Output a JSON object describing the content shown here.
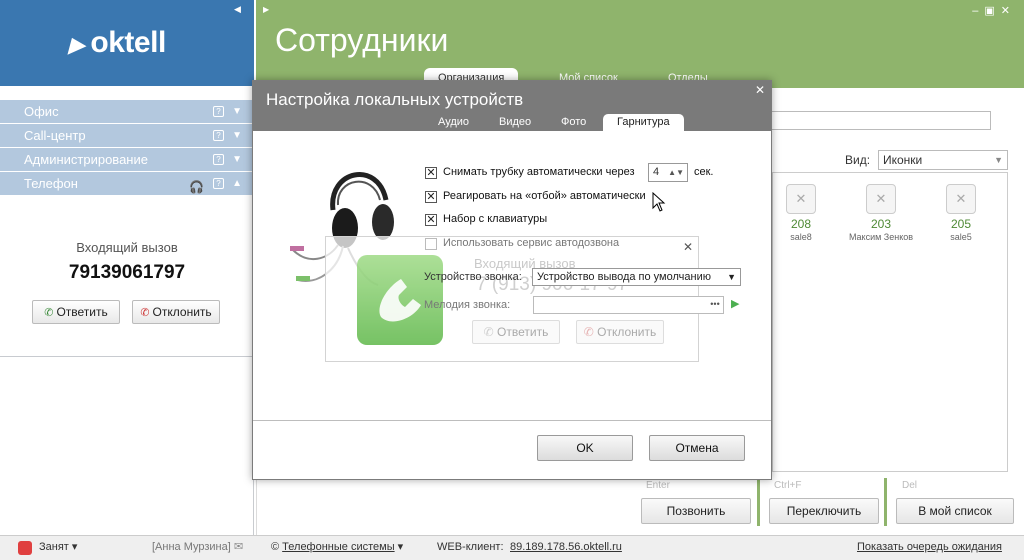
{
  "brand": {
    "logo": "oktell"
  },
  "sidebar": {
    "items": [
      {
        "label": "Офис",
        "expanded": false
      },
      {
        "label": "Call-центр",
        "expanded": false
      },
      {
        "label": "Администрирование",
        "expanded": false
      },
      {
        "label": "Телефон",
        "expanded": true
      }
    ],
    "incoming_label": "Входящий вызов",
    "incoming_number": "79139061797",
    "answer_label": "Ответить",
    "decline_label": "Отклонить"
  },
  "main": {
    "title": "Сотрудники",
    "tabs": [
      "Организация",
      "Мой список",
      "Отделы"
    ],
    "active_tab": "Организация",
    "view_label": "Вид:",
    "view_value": "Иконки",
    "employees": [
      {
        "num": "208",
        "name": "sale8"
      },
      {
        "num": "203",
        "name": "Максим Зенков"
      },
      {
        "num": "205",
        "name": "sale5"
      }
    ],
    "hints": [
      "Enter",
      "Ctrl+F",
      "Del"
    ],
    "buttons": [
      "Позвонить",
      "Переключить",
      "В мой список"
    ]
  },
  "dialog": {
    "title": "Настройка локальных устройств",
    "tabs": [
      "Аудио",
      "Видео",
      "Фото",
      "Гарнитура"
    ],
    "active_tab": "Гарнитура",
    "auto_pickup_label": "Снимать трубку автоматически через",
    "auto_pickup_value": "4",
    "auto_pickup_unit": "сек.",
    "auto_hangup_label": "Реагировать на «отбой» автоматически",
    "keypad_label": "Набор с клавиатуры",
    "autodial_label": "Использовать сервис автодозвона",
    "checks": {
      "auto_pickup": true,
      "auto_hangup": true,
      "keypad": true,
      "autodial": false
    },
    "preview": {
      "ghost_title": "Входящий вызов",
      "ghost_number": "7 (913) 906-17-97",
      "device_label": "Устройство звонка:",
      "device_value": "Устройство вывода по умолчанию",
      "melody_label": "Мелодия звонка:",
      "melody_value": "",
      "answer_label": "Ответить",
      "decline_label": "Отклонить"
    },
    "ok_label": "OK",
    "cancel_label": "Отмена"
  },
  "status_bar": {
    "state": "Занят",
    "user": "[Анна Мурзина]",
    "company": "Телефонные системы",
    "web_label": "WEB-клиент:",
    "web_url": "89.189.178.56.oktell.ru",
    "queue_link": "Показать очередь ожидания"
  },
  "colors": {
    "brand_blue": "#3a77b0",
    "header_green": "#8fb46c",
    "busy_red": "#e04040"
  }
}
